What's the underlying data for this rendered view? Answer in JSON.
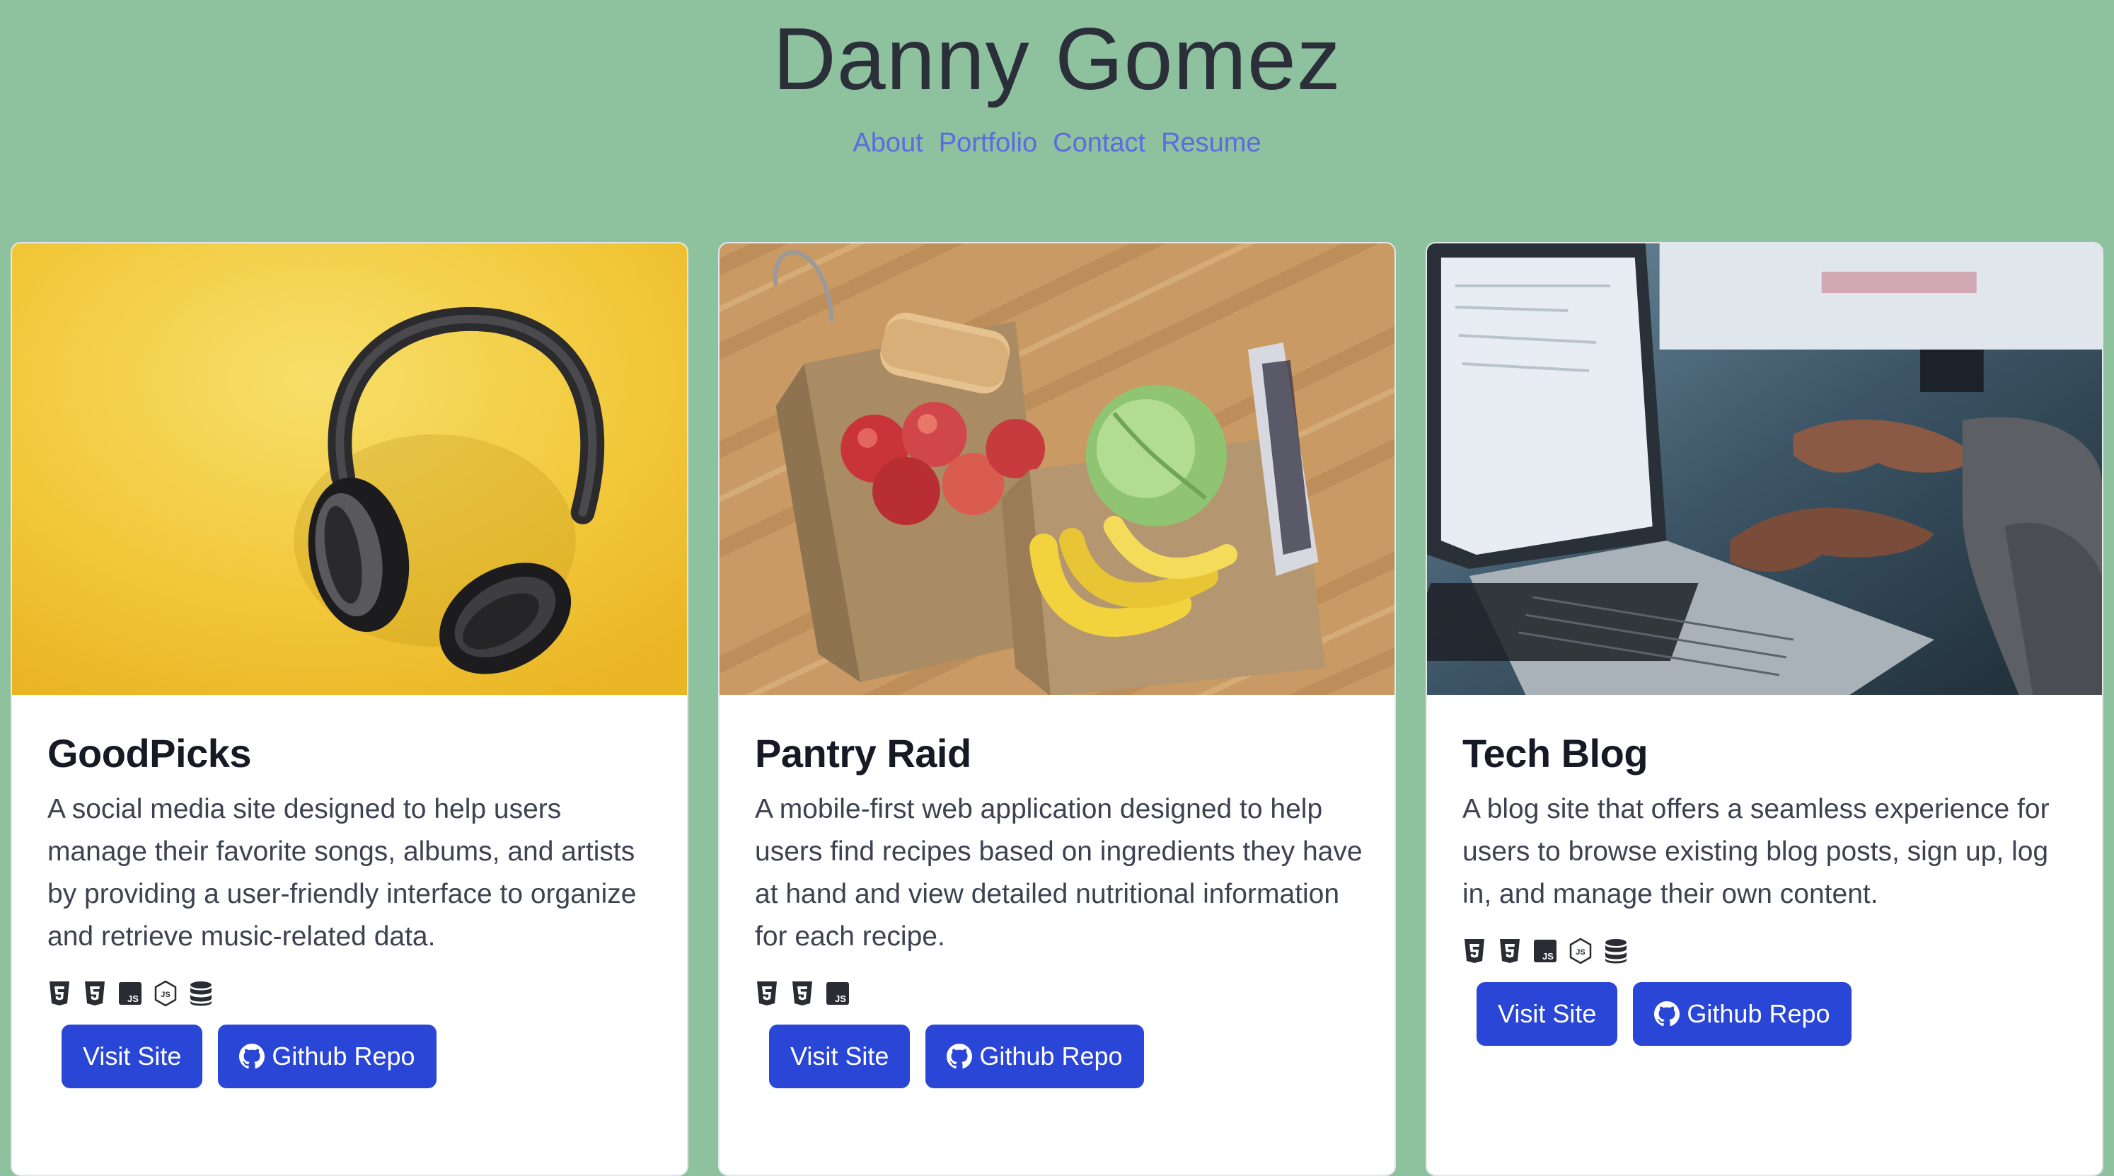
{
  "header": {
    "title": "Danny Gomez",
    "nav": [
      "About",
      "Portfolio",
      "Contact",
      "Resume"
    ]
  },
  "projects": [
    {
      "title": "GoodPicks",
      "description": "A social media site designed to help users manage their favorite songs, albums, and artists by providing a user-friendly interface to organize and retrieve music-related data.",
      "image": "headphones-on-yellow-photo",
      "tech_icons": [
        "html5-icon",
        "css3-icon",
        "javascript-icon",
        "nodejs-icon",
        "database-icon"
      ],
      "visit_label": "Visit Site",
      "repo_label": "Github Repo"
    },
    {
      "title": "Pantry Raid",
      "description": "A mobile-first web application designed to help users find recipes based on ingredients they have at hand and view detailed nutritional information for each recipe.",
      "image": "grocery-bags-photo",
      "tech_icons": [
        "html5-icon",
        "css3-icon",
        "javascript-icon"
      ],
      "visit_label": "Visit Site",
      "repo_label": "Github Repo"
    },
    {
      "title": "Tech Blog",
      "description": "A blog site that offers a seamless experience for users to browse existing blog posts, sign up, log in, and manage their own content.",
      "image": "laptop-typing-photo",
      "tech_icons": [
        "html5-icon",
        "css3-icon",
        "javascript-icon",
        "nodejs-icon",
        "database-icon"
      ],
      "visit_label": "Visit Site",
      "repo_label": "Github Repo"
    }
  ],
  "colors": {
    "background": "#8ec19d",
    "title": "#2a2f3a",
    "nav_link": "#5c6bdf",
    "button": "#2946d6"
  }
}
